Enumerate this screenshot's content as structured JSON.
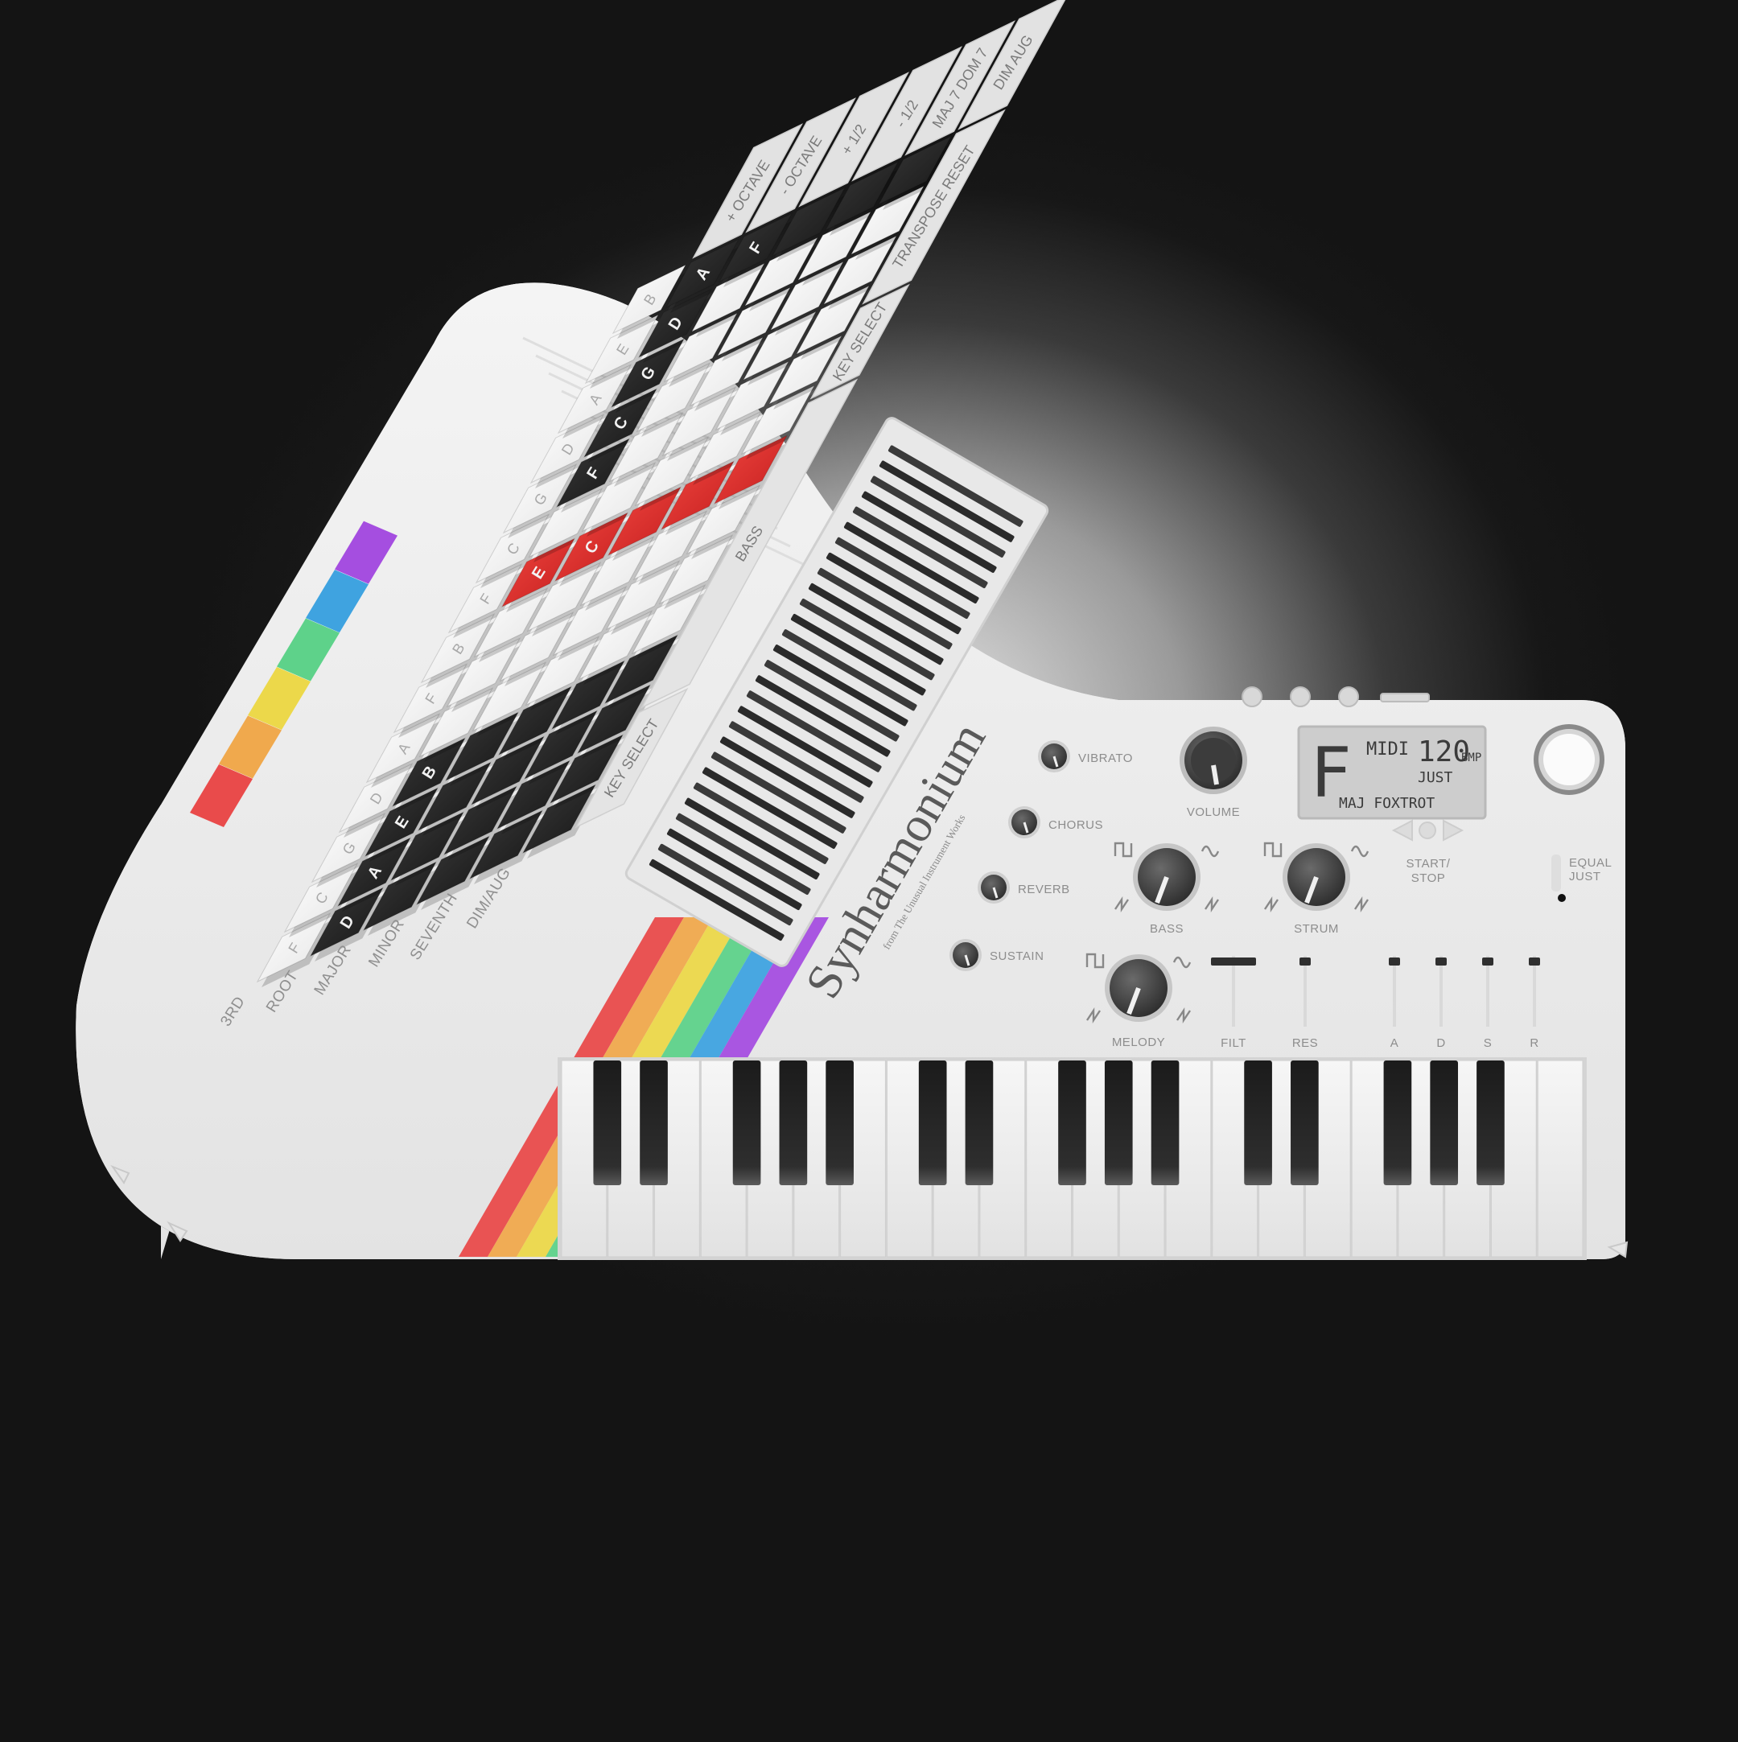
{
  "brand": {
    "name": "Synharmonium",
    "subtitle": "from The Unusual Instrument Works"
  },
  "display": {
    "key": "F",
    "mode": "MIDI",
    "tempo": "120",
    "tempo_unit": "BMP",
    "tuning": "JUST",
    "patch": "MAJ FOXTROT"
  },
  "effects": [
    {
      "label": "VIBRATO"
    },
    {
      "label": "CHORUS"
    },
    {
      "label": "REVERB"
    },
    {
      "label": "SUSTAIN"
    }
  ],
  "knobs": {
    "volume": "VOLUME",
    "bass": "BASS",
    "strum": "STRUM",
    "melody": "MELODY"
  },
  "sliders": {
    "filt": "FILT",
    "res": "RES",
    "a": "A",
    "d": "D",
    "s": "S",
    "r": "R"
  },
  "transport": {
    "start_stop_line1": "START/",
    "start_stop_line2": "STOP",
    "tuning_switch_line1": "EQUAL",
    "tuning_switch_line2": "JUST"
  },
  "grid": {
    "function_keys": [
      "+ OCTAVE",
      "- OCTAVE",
      "+ 1/2",
      "- 1/2",
      "MAJ 7",
      "DOM 7",
      "DIM",
      "AUG"
    ],
    "transpose_reset": "TRANSPOSE RESET",
    "key_select": "KEY SELECT",
    "bass": "BASS",
    "row_labels": [
      "3RD",
      "ROOT",
      "MAJOR",
      "MINOR",
      "SEVENTH",
      "DIM/AUG"
    ],
    "third_notes": [
      "F",
      "C",
      "G",
      "D",
      "A",
      "F",
      "B",
      "F",
      "C",
      "G",
      "D",
      "A",
      "E",
      "B"
    ],
    "top_dark_notes": [
      "F",
      "C",
      "G",
      "D",
      "A"
    ],
    "f_key": "F",
    "red_notes": [
      "E",
      "C"
    ],
    "root_notes": [
      "D",
      "A",
      "E",
      "B"
    ]
  },
  "colors": {
    "rainbow": [
      "#e94b4b",
      "#f0a94d",
      "#ecd84a",
      "#5ed28a",
      "#3fa3e0",
      "#a54ee0"
    ],
    "accent_red": "#e0302f",
    "body": "#efefef",
    "key_dark": "#2a2a2a"
  }
}
